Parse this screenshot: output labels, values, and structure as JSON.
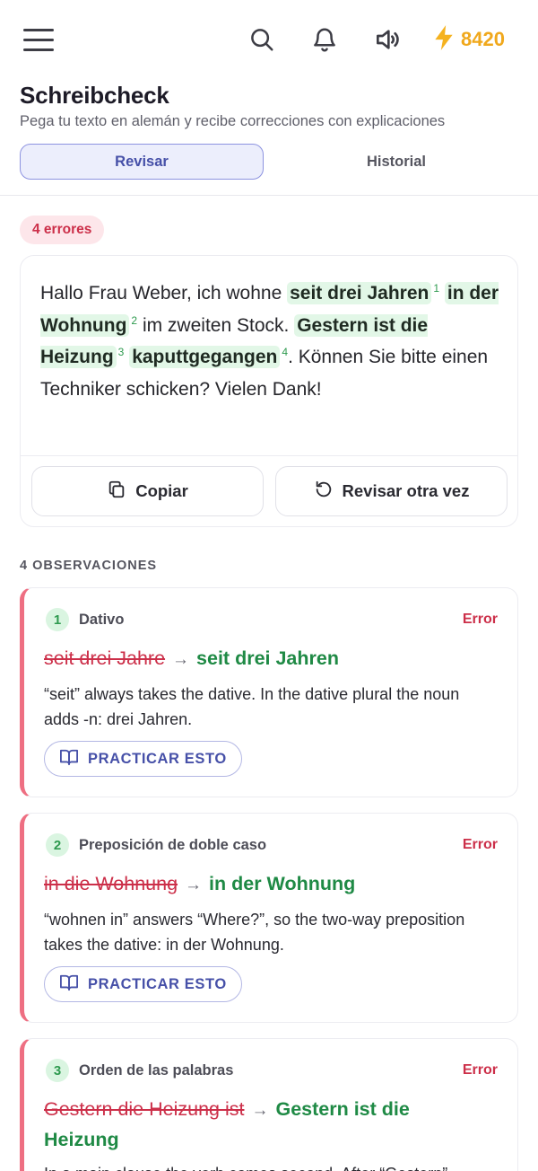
{
  "topbar": {
    "menu_icon": "hamburger-menu-icon",
    "search_icon": "search-icon",
    "notifications_icon": "bell-icon",
    "audio_icon": "speaker-icon",
    "xp_icon": "lightning-bolt-icon",
    "xp_value": "8420"
  },
  "header": {
    "title": "Schreibcheck",
    "subtitle": "Pega tu texto en alemán y recibe correcciones con explicaciones"
  },
  "tabs": [
    {
      "label": "Revisar",
      "active": true
    },
    {
      "label": "Historial",
      "active": false
    }
  ],
  "result": {
    "error_badge": "4 errores",
    "text": {
      "p1": "Hallo Frau Weber, ich wohne ",
      "h1": "seit drei Jahren",
      "n1": "1",
      "h2": "in der Wohnung",
      "n2": "2",
      "p2": " im zweiten Stock.",
      "h3": "Gestern ist die Heizung",
      "n3": "3",
      "h4": "kaputtgegangen",
      "n4": "4",
      "p3": ". Können Sie bitte einen Techniker schicken? Vielen Dank!"
    },
    "copy_label": "Copiar",
    "copy_icon": "copy-icon",
    "recheck_label": "Revisar otra vez",
    "recheck_icon": "rotate-ccw-icon"
  },
  "observations": {
    "heading": "4 OBSERVACIONES",
    "practice_icon": "book-open-icon",
    "items": [
      {
        "num": "1",
        "category": "Dativo",
        "type": "Error",
        "old": "seit drei Jahre",
        "arrow": "→",
        "new": "seit drei Jahren",
        "explanation": "“seit” always takes the dative. In the dative plural the noun adds -n: drei Jahren.",
        "practice_label": "PRACTICAR ESTO"
      },
      {
        "num": "2",
        "category": "Preposición de doble caso",
        "type": "Error",
        "old": "in die Wohnung",
        "arrow": "→",
        "new": "in der Wohnung",
        "explanation": "“wohnen in” answers “Where?”, so the two-way preposition takes the dative: in der Wohnung.",
        "practice_label": "PRACTICAR ESTO"
      },
      {
        "num": "3",
        "category": "Orden de las palabras",
        "type": "Error",
        "old": "Gestern die Heizung ist",
        "arrow": "→",
        "new": "Gestern ist die Heizung",
        "explanation": "In a main clause the verb comes second. After “Gestern”"
      }
    ]
  },
  "colors": {
    "accent": "#4650a8",
    "error": "#cc2f49",
    "correct": "#1f8a45",
    "highlight": "#e2f7e7",
    "xp": "#f0a81c"
  }
}
